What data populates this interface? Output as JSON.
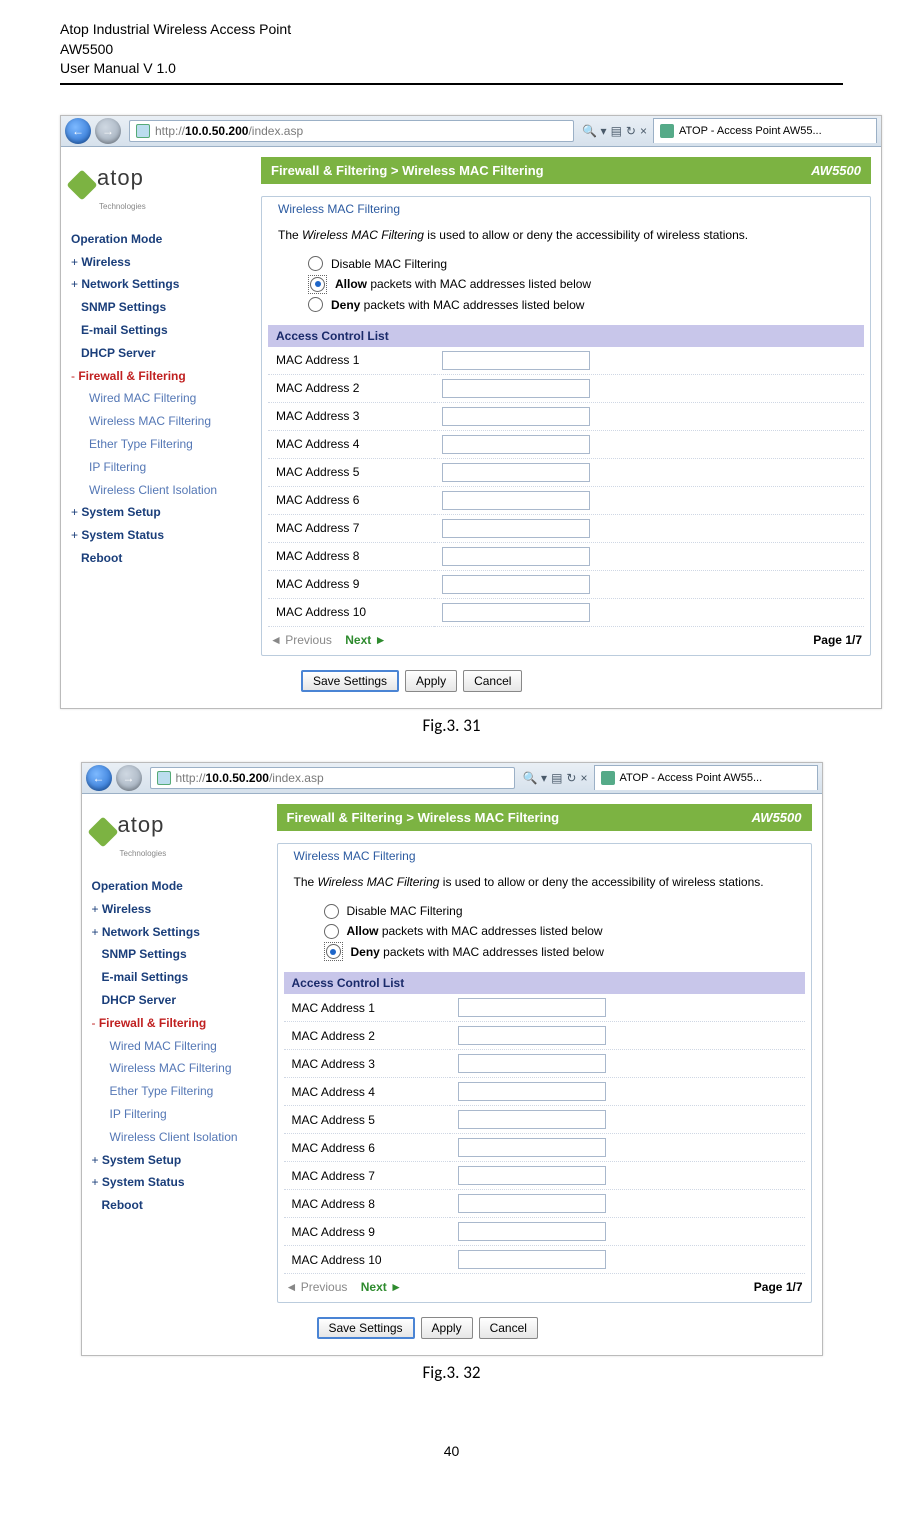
{
  "doc": {
    "h1": "Atop Industrial Wireless Access Point",
    "h2": "AW5500",
    "h3": "User Manual V 1.0",
    "page_number": "40"
  },
  "captions": {
    "fig1": "Fig.3. 31",
    "fig2": "Fig.3. 32"
  },
  "browser": {
    "url_prefix": "http://",
    "url_host": "10.0.50.200",
    "url_path": "/index.asp",
    "search_icon": "🔍",
    "tools": "⚙",
    "refresh": "↻",
    "close": "×",
    "tab_title": "ATOP - Access Point AW55..."
  },
  "logo": {
    "name": "atop",
    "sub": "Technologies"
  },
  "nav": {
    "operation_mode": "Operation Mode",
    "wireless": "Wireless",
    "network": "Network Settings",
    "snmp": "SNMP Settings",
    "email": "E-mail Settings",
    "dhcp": "DHCP Server",
    "firewall": "Firewall & Filtering",
    "f_wired": "Wired MAC Filtering",
    "f_wireless": "Wireless MAC Filtering",
    "f_ether": "Ether Type Filtering",
    "f_ip": "IP Filtering",
    "f_iso": "Wireless Client Isolation",
    "setup": "System Setup",
    "status": "System Status",
    "reboot": "Reboot",
    "plus": "+",
    "minus": "-"
  },
  "content": {
    "breadcrumb": "Firewall & Filtering > Wireless MAC Filtering",
    "model": "AW5500",
    "fieldset_title": "Wireless MAC Filtering",
    "intro_pre": "The ",
    "intro_em": "Wireless MAC Filtering",
    "intro_post": " is used to allow or deny the accessibility of wireless stations.",
    "radio_disable": "Disable MAC Filtering",
    "radio_allow_b": "Allow",
    "radio_allow_t": " packets with MAC addresses listed below",
    "radio_deny_b": "Deny",
    "radio_deny_t": " packets with MAC addresses listed below",
    "acl_header": "Access Control List",
    "mac_rows": [
      "MAC Address 1",
      "MAC Address 2",
      "MAC Address 3",
      "MAC Address 4",
      "MAC Address 5",
      "MAC Address 6",
      "MAC Address 7",
      "MAC Address 8",
      "MAC Address 9",
      "MAC Address 10"
    ],
    "prev": "◄ Previous",
    "next": "Next ►",
    "page_ind": "Page 1/7",
    "btn_save": "Save Settings",
    "btn_apply": "Apply",
    "btn_cancel": "Cancel"
  }
}
